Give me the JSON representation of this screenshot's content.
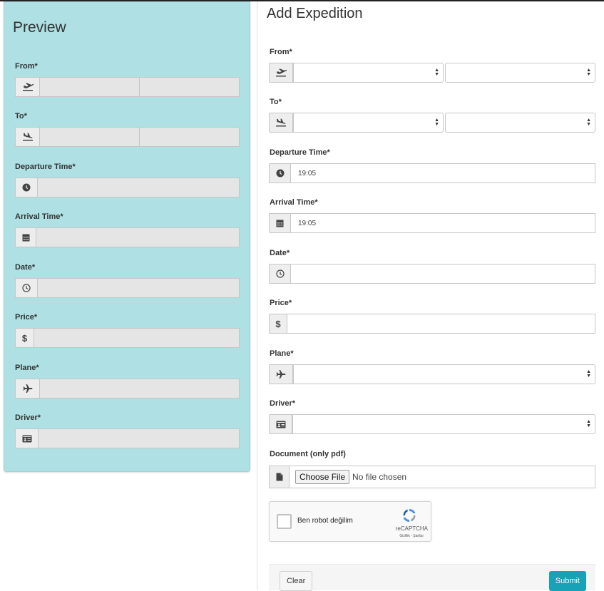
{
  "preview": {
    "title": "Preview",
    "labels": {
      "from": "From*",
      "to": "To*",
      "departure": "Departure Time*",
      "arrival": "Arrival Time*",
      "date": "Date*",
      "price": "Price*",
      "plane": "Plane*",
      "driver": "Driver*"
    },
    "price_symbol": "$"
  },
  "form": {
    "title": "Add Expedition",
    "labels": {
      "from": "From*",
      "to": "To*",
      "departure": "Departure Time*",
      "arrival": "Arrival Time*",
      "date": "Date*",
      "price": "Price*",
      "plane": "Plane*",
      "driver": "Driver*",
      "document": "Document (only pdf)"
    },
    "departure_value": "19:05",
    "arrival_value": "19:05",
    "price_symbol": "$",
    "file": {
      "choose_label": "Choose File",
      "status": "No file chosen"
    },
    "captcha": {
      "label": "Ben robot değilim",
      "brand": "reCAPTCHA",
      "terms": "Gizlilik - Şartlar"
    },
    "clear_label": "Clear",
    "submit_label": "Submit"
  },
  "colors": {
    "preview_bg": "#aee0e4",
    "submit_bg": "#17a2b8"
  }
}
